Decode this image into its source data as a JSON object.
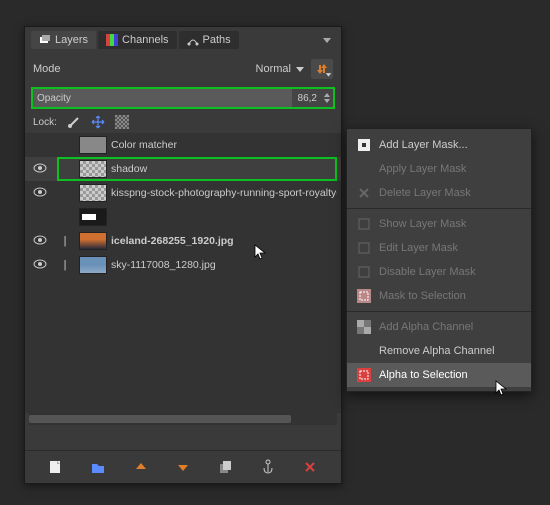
{
  "tabs": {
    "layers": "Layers",
    "channels": "Channels",
    "paths": "Paths"
  },
  "mode": {
    "label": "Mode",
    "value": "Normal"
  },
  "opacity": {
    "label": "Opacity",
    "value": "86,2"
  },
  "lock": {
    "label": "Lock:"
  },
  "layers": [
    {
      "name": "Color matcher",
      "visible": false,
      "bold": false,
      "thumb": "plain",
      "link": ""
    },
    {
      "name": "shadow",
      "visible": true,
      "bold": false,
      "thumb": "checker",
      "link": "",
      "highlighted": true,
      "selected": true
    },
    {
      "name": "kisspng-stock-photography-running-sport-royalty-free",
      "visible": true,
      "bold": false,
      "thumb": "checker",
      "link": ""
    },
    {
      "name": "",
      "visible": false,
      "bold": false,
      "thumb": "dark",
      "link": ""
    },
    {
      "name": "iceland-268255_1920.jpg",
      "visible": true,
      "bold": true,
      "thumb": "photo2",
      "link": "|"
    },
    {
      "name": "sky-1117008_1280.jpg",
      "visible": true,
      "bold": false,
      "thumb": "photo3",
      "link": "|"
    }
  ],
  "context_menu": [
    {
      "label": "Add Layer Mask...",
      "icon": "mask-add",
      "disabled": false
    },
    {
      "label": "Apply Layer Mask",
      "icon": "",
      "disabled": true
    },
    {
      "label": "Delete Layer Mask",
      "icon": "delete",
      "disabled": true
    },
    {
      "sep": true
    },
    {
      "label": "Show Layer Mask",
      "icon": "check",
      "disabled": true
    },
    {
      "label": "Edit Layer Mask",
      "icon": "check",
      "disabled": true
    },
    {
      "label": "Disable Layer Mask",
      "icon": "check",
      "disabled": true
    },
    {
      "label": "Mask to Selection",
      "icon": "mask-sel",
      "disabled": true
    },
    {
      "sep": true
    },
    {
      "label": "Add Alpha Channel",
      "icon": "alpha-add",
      "disabled": true
    },
    {
      "label": "Remove Alpha Channel",
      "icon": "",
      "disabled": false
    },
    {
      "label": "Alpha to Selection",
      "icon": "alpha-sel",
      "disabled": false,
      "highlighted": true
    }
  ],
  "colors": {
    "accent_orange": "#e07f2a",
    "accent_blue": "#5a8cff",
    "highlight_green": "#0dbf1f",
    "danger": "#d94040"
  }
}
